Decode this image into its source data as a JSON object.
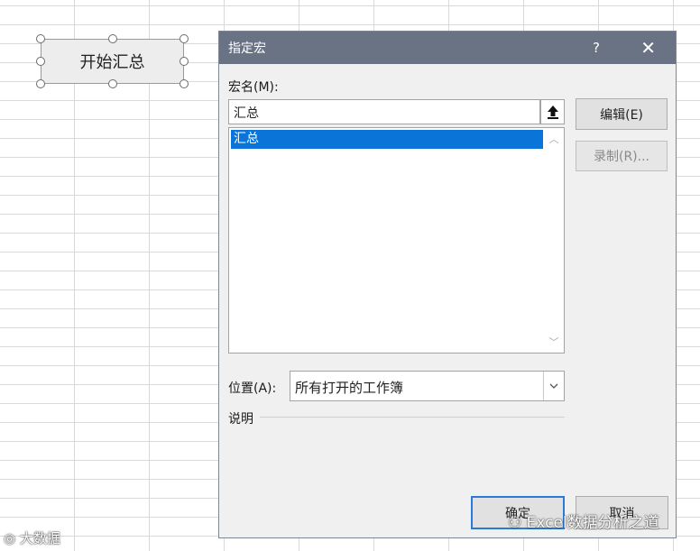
{
  "sheet": {
    "shape_label": "开始汇总"
  },
  "dialog": {
    "title": "指定宏",
    "help_label": "?",
    "close_label": "✕",
    "macro_name_label": "宏名(M):",
    "macro_name_value": "汇总",
    "macros": [
      "汇总"
    ],
    "edit_button": "编辑(E)",
    "record_button": "录制(R)...",
    "location_label": "位置(A):",
    "location_value": "所有打开的工作簿",
    "description_label": "说明",
    "ok_button": "确定",
    "cancel_button": "取消"
  },
  "watermarks": {
    "left": "大数据",
    "right": "Excel数据分析之道"
  },
  "colors": {
    "titlebar": "#6a7384",
    "selection": "#0a74d9",
    "dialog_bg": "#f0f0f0"
  }
}
